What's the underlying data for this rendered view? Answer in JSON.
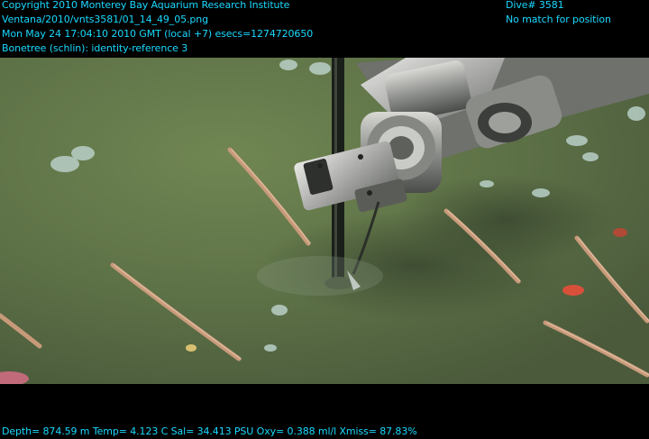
{
  "overlay": {
    "copyright": "Copyright 2010 Monterey Bay Aquarium Research Institute",
    "image_path": "Ventana/2010/vnts3581/01_14_49_05.png",
    "timestamp_line": "Mon May 24 17:04:10 2010 GMT (local +7)  esecs=1274720650",
    "annotation": "Bonetree (schlin): identity-reference 3",
    "dive": "Dive# 3581",
    "position_status": "No match for position",
    "telemetry": "Depth= 874.59 m  Temp= 4.123 C  Sal= 34.413 PSU  Oxy= 0.388 ml/l  Xmiss= 87.83%"
  },
  "colors": {
    "overlay_text": "#19d9ff",
    "seafloor": "#5c7046",
    "robot_arm": "#9a9a96",
    "sea_pen": "#c79a7a"
  },
  "scene": {
    "subject": "ROV manipulator arm on muddy seafloor with sea pens"
  }
}
